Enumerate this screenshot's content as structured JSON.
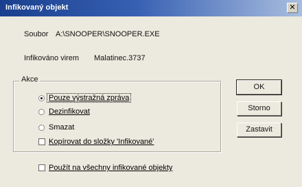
{
  "window": {
    "title": "Infikovaný objekt",
    "close_glyph": "✕"
  },
  "info": {
    "file_label": "Soubor",
    "file_value": "A:\\SNOOPER\\SNOOPER.EXE",
    "virus_label": "Infikováno virem",
    "virus_value": "Malatinec.3737"
  },
  "actions": {
    "group_title": "Akce",
    "options": [
      {
        "label": "Pouze výstražná zpráva",
        "type": "radio",
        "selected": true
      },
      {
        "label": "Dezinfikovat",
        "type": "radio",
        "selected": false
      },
      {
        "label": "Smazat",
        "type": "radio",
        "selected": false
      },
      {
        "label": "Kopírovat do složky 'Infikované'",
        "type": "checkbox",
        "checked": false
      }
    ]
  },
  "apply_all": {
    "label": "Použít na všechny infikované objekty",
    "checked": false
  },
  "buttons": {
    "ok": "OK",
    "cancel": "Storno",
    "stop": "Zastavit"
  }
}
